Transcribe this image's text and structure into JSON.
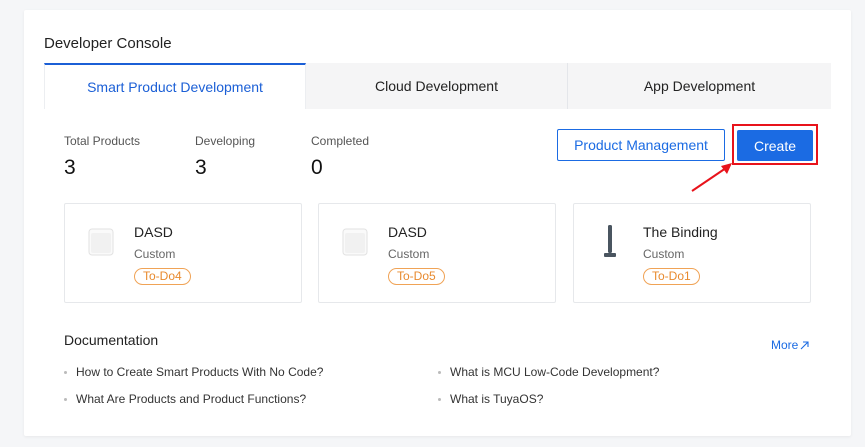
{
  "console": {
    "title": "Developer Console"
  },
  "tabs": [
    {
      "label": "Smart Product Development"
    },
    {
      "label": "Cloud Development"
    },
    {
      "label": "App Development"
    }
  ],
  "stats": [
    {
      "label": "Total Products",
      "value": "3"
    },
    {
      "label": "Developing",
      "value": "3"
    },
    {
      "label": "Completed",
      "value": "0"
    }
  ],
  "actions": {
    "manage_label": "Product Management",
    "create_label": "Create"
  },
  "products": [
    {
      "name": "DASD",
      "type": "Custom",
      "badge": "To-Do4",
      "icon": "socket-device-icon"
    },
    {
      "name": "DASD",
      "type": "Custom",
      "badge": "To-Do5",
      "icon": "socket-device-icon"
    },
    {
      "name": "The Binding",
      "type": "Custom",
      "badge": "To-Do1",
      "icon": "pole-device-icon"
    }
  ],
  "docs": {
    "title": "Documentation",
    "more_label": "More",
    "links": [
      "How to Create Smart Products With No Code?",
      "What is MCU Low-Code Development?",
      "What Are Products and Product Functions?",
      "What is TuyaOS?"
    ]
  },
  "colors": {
    "accent": "#1b6be3",
    "highlight": "#e8131b",
    "badge": "#e88a2e"
  }
}
